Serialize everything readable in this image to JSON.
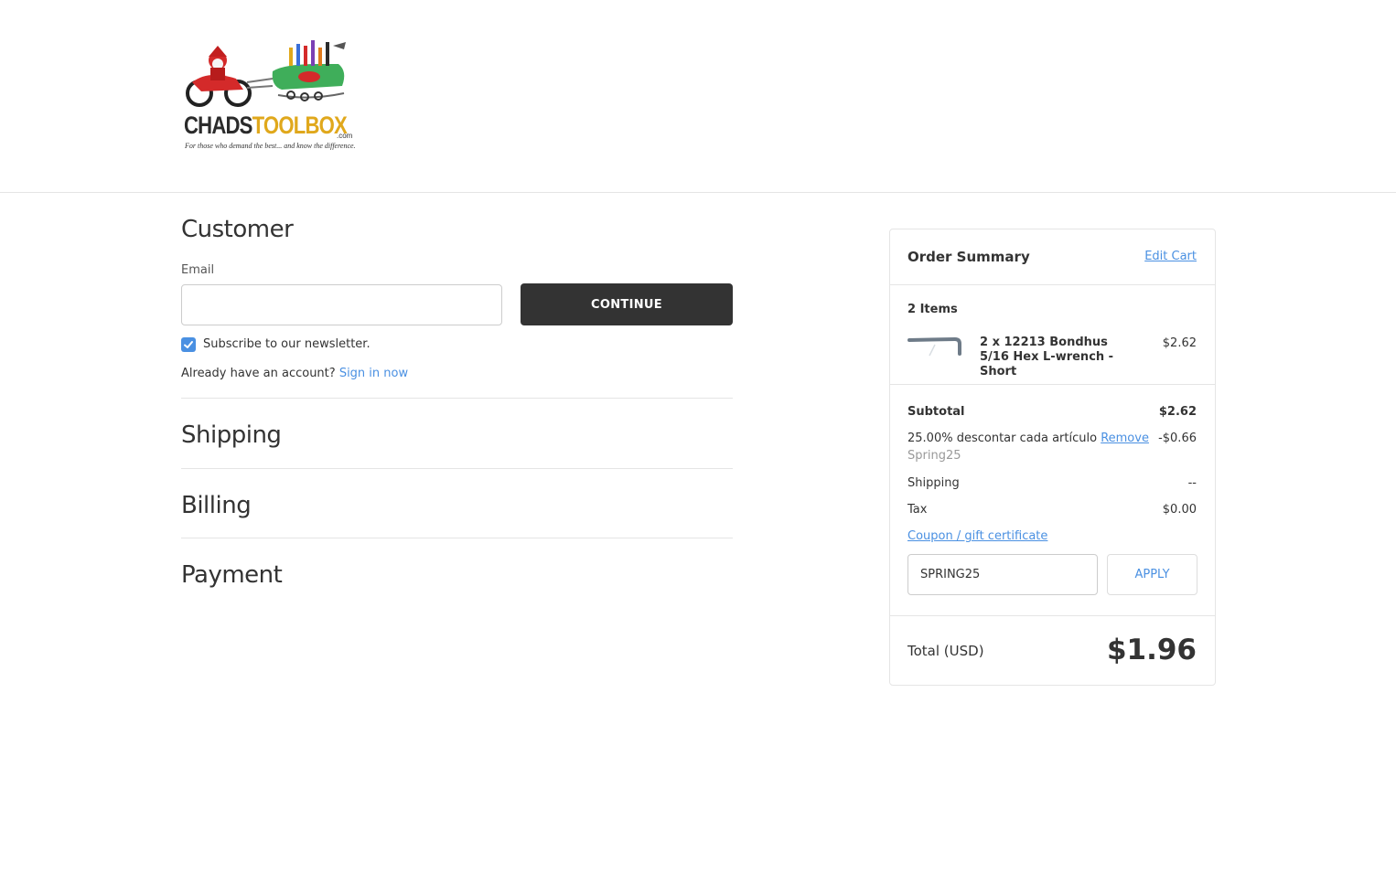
{
  "brand": {
    "word_part1": "CHADS",
    "word_part2": "TOOLBOX",
    "domain_suffix": ".com",
    "tagline": "For those who demand the best... and know the difference."
  },
  "checkout": {
    "customer": {
      "heading": "Customer",
      "email_label": "Email",
      "email_value": "",
      "email_placeholder": "",
      "continue_label": "CONTINUE",
      "subscribe_checked": true,
      "subscribe_label": "Subscribe to our newsletter.",
      "account_prompt": "Already have an account?",
      "sign_in_label": "Sign in now"
    },
    "sections": {
      "shipping": "Shipping",
      "billing": "Billing",
      "payment": "Payment"
    }
  },
  "summary": {
    "title": "Order Summary",
    "edit_cart_label": "Edit Cart",
    "items_count_label": "2 Items",
    "items": [
      {
        "name": "2 x 12213 Bondhus 5/16 Hex L-wrench - Short",
        "price": "$2.62"
      }
    ],
    "subtotal_label": "Subtotal",
    "subtotal_value": "$2.62",
    "discount_label": "25.00% descontar cada artículo",
    "discount_remove_label": "Remove",
    "discount_code": "Spring25",
    "discount_value": "-$0.66",
    "shipping_label": "Shipping",
    "shipping_value": "--",
    "tax_label": "Tax",
    "tax_value": "$0.00",
    "coupon_link_label": "Coupon / gift certificate",
    "coupon_input_value": "SPRING25",
    "apply_label": "APPLY",
    "total_label": "Total (USD)",
    "total_value": "$1.96"
  },
  "colors": {
    "link": "#4a90e2",
    "button_dark": "#333333",
    "border": "#e5e5e5"
  }
}
